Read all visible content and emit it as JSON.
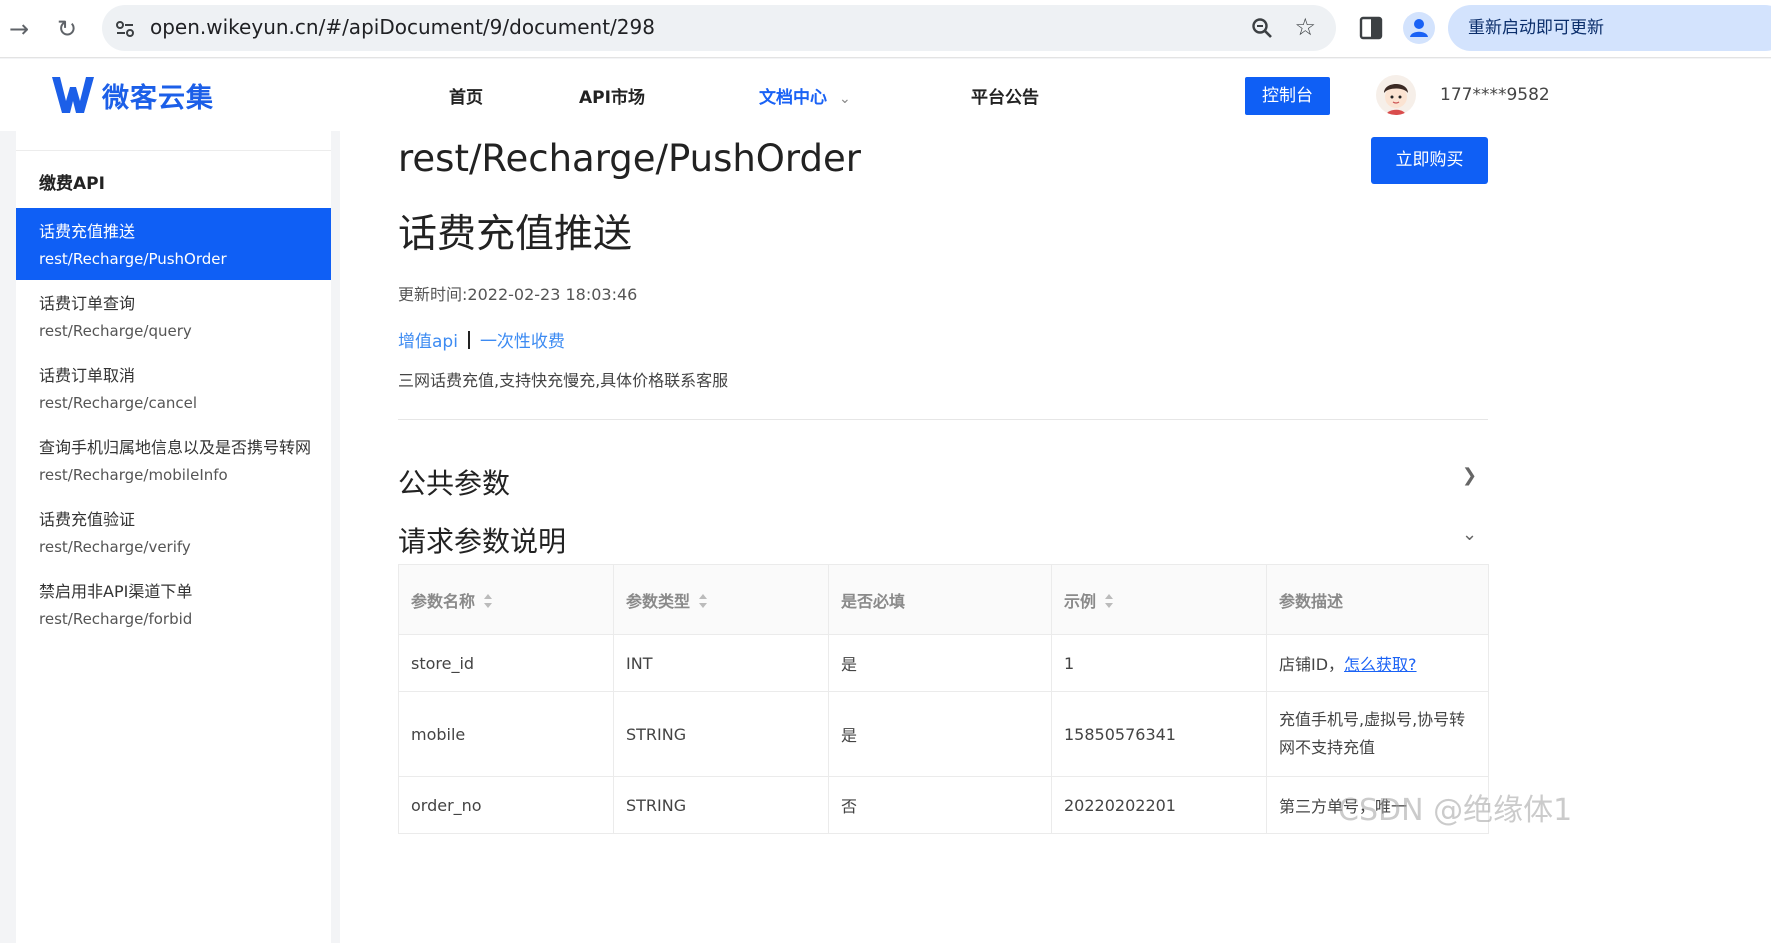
{
  "browser": {
    "url": "open.wikeyun.cn/#/apiDocument/9/document/298",
    "restart_label": "重新启动即可更新"
  },
  "header": {
    "logo_text": "微客云集",
    "nav": [
      {
        "label": "首页"
      },
      {
        "label": "API市场"
      },
      {
        "label": "文档中心"
      },
      {
        "label": "平台公告"
      }
    ],
    "console_label": "控制台",
    "user_phone": "177****9582",
    "accent_color": "#0f5ff5"
  },
  "sidebar": {
    "section_title": "缴费API",
    "items": [
      {
        "name": "话费充值推送",
        "path": "rest/Recharge/PushOrder",
        "active": true
      },
      {
        "name": "话费订单查询",
        "path": "rest/Recharge/query"
      },
      {
        "name": "话费订单取消",
        "path": "rest/Recharge/cancel"
      },
      {
        "name": "查询手机归属地信息以及是否携号转网",
        "path": "rest/Recharge/mobileInfo"
      },
      {
        "name": "话费充值验证",
        "path": "rest/Recharge/verify"
      },
      {
        "name": "禁启用非API渠道下单",
        "path": "rest/Recharge/forbid"
      }
    ]
  },
  "main": {
    "api_path": "rest/Recharge/PushOrder",
    "buy_label": "立即购买",
    "title": "话费充值推送",
    "updated_label": "更新时间:",
    "updated_value": "2022-02-23 18:03:46",
    "tags": [
      "增值api",
      "一次性收费"
    ],
    "description": "三网话费充值,支持快充慢充,具体价格联系客服",
    "sections": {
      "public_params": "公共参数",
      "request_params": "请求参数说明"
    },
    "table": {
      "headers": [
        "参数名称",
        "参数类型",
        "是否必填",
        "示例",
        "参数描述"
      ],
      "rows": [
        {
          "name": "store_id",
          "type": "INT",
          "required": "是",
          "example": "1",
          "desc": "店铺ID，",
          "link": "怎么获取?"
        },
        {
          "name": "mobile",
          "type": "STRING",
          "required": "是",
          "example": "15850576341",
          "desc": "充值手机号,虚拟号,协号转网不支持充值"
        },
        {
          "name": "order_no",
          "type": "STRING",
          "required": "否",
          "example": "20220202201",
          "desc": "第三方单号，唯一"
        }
      ]
    }
  },
  "watermark": "CSDN @绝缘体1"
}
